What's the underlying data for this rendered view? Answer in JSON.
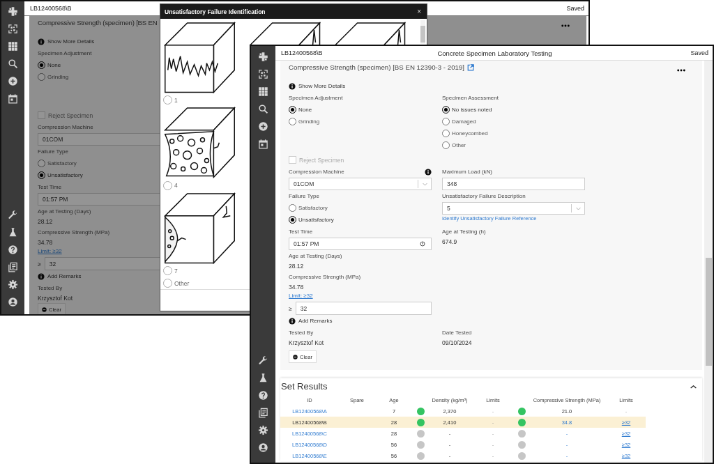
{
  "back_window": {
    "record_id": "LB12400568\\B",
    "status": "Saved",
    "card_title": "Compressive Strength (specimen) [BS EN",
    "rows": [
      {
        "left": [
          {
            "kind": "info_link",
            "text": "Show More Details"
          }
        ]
      },
      {
        "left": [
          {
            "kind": "label",
            "text": "Specimen Adjustment"
          },
          {
            "kind": "radio",
            "text": "None",
            "selected": true
          },
          {
            "kind": "radio",
            "text": "Grinding",
            "selected": false
          }
        ]
      },
      {
        "left": [
          {
            "kind": "checkbox",
            "text": "Reject Specimen",
            "checked": false,
            "disabled": true
          }
        ]
      },
      {
        "left": [
          {
            "kind": "label",
            "text": "Compression Machine"
          },
          {
            "kind": "select",
            "value": "01COM"
          },
          {
            "kind": "label",
            "text": "Failure Type"
          },
          {
            "kind": "radio",
            "text": "Satisfactory",
            "selected": false
          },
          {
            "kind": "radio",
            "text": "Unsatisfactory",
            "selected": true
          }
        ]
      },
      {
        "left": [
          {
            "kind": "label",
            "text": "Test Time"
          },
          {
            "kind": "time",
            "value": "01:57 PM"
          },
          {
            "kind": "label",
            "text": "Age at Testing (Days)"
          },
          {
            "kind": "value",
            "text": "28.12"
          },
          {
            "kind": "label",
            "text": "Compressive Strength (MPa)"
          },
          {
            "kind": "value",
            "text": "34.78"
          },
          {
            "kind": "limit_link",
            "text": "Limit: ≥32"
          },
          {
            "kind": "prefixed_input",
            "prefix": "≥",
            "value": "32"
          }
        ]
      },
      {
        "left": [
          {
            "kind": "info_link",
            "text": "Add Remarks"
          }
        ]
      },
      {
        "left": [
          {
            "kind": "label",
            "text": "Tested By"
          },
          {
            "kind": "value",
            "text": "Krzysztof Kot"
          },
          {
            "kind": "button",
            "text": "Clear"
          }
        ]
      }
    ]
  },
  "modal": {
    "title": "Unsatisfactory Failure Identification",
    "close": "×",
    "options": [
      {
        "kind": "image",
        "label": "1",
        "selected": false
      },
      {
        "kind": "image",
        "label": "4",
        "selected": false
      },
      {
        "kind": "image",
        "label": "7",
        "selected": false
      },
      {
        "kind": "plain",
        "label": "Other",
        "selected": false
      }
    ]
  },
  "front_window": {
    "record_id": "LB12400568\\B",
    "title": "Concrete Specimen Laboratory Testing",
    "status": "Saved",
    "card_title": "Compressive Strength (specimen) [BS EN 12390-3 - 2019]",
    "external_link": true,
    "rows": [
      {
        "left": [
          {
            "kind": "info_link",
            "text": "Show More Details"
          }
        ]
      },
      {
        "left": [
          {
            "kind": "label",
            "text": "Specimen Adjustment"
          },
          {
            "kind": "radio",
            "text": "None",
            "selected": true
          },
          {
            "kind": "radio",
            "text": "Grinding",
            "selected": false
          }
        ],
        "right": [
          {
            "kind": "label",
            "text": "Specimen Assessment"
          },
          {
            "kind": "radio",
            "text": "No issues noted",
            "selected": true
          },
          {
            "kind": "radio",
            "text": "Damaged",
            "selected": false
          },
          {
            "kind": "radio",
            "text": "Honeycombed",
            "selected": false
          },
          {
            "kind": "radio",
            "text": "Other",
            "selected": false
          }
        ]
      },
      {
        "left": [
          {
            "kind": "checkbox",
            "text": "Reject Specimen",
            "checked": false,
            "disabled": true
          }
        ]
      },
      {
        "left": [
          {
            "kind": "label",
            "text": "Compression Machine",
            "info": true
          },
          {
            "kind": "select",
            "value": "01COM"
          },
          {
            "kind": "label",
            "text": "Failure Type"
          },
          {
            "kind": "radio",
            "text": "Satisfactory",
            "selected": false
          },
          {
            "kind": "radio",
            "text": "Unsatisfactory",
            "selected": true
          }
        ],
        "right": [
          {
            "kind": "label",
            "text": "Maximum Load (kN)"
          },
          {
            "kind": "input",
            "value": "348"
          },
          {
            "kind": "label",
            "text": "Unsatisfactory Failure Description"
          },
          {
            "kind": "select",
            "value": "5"
          },
          {
            "kind": "link",
            "text": "Identify Unsatisfactory Failure Reference"
          }
        ]
      },
      {
        "left": [
          {
            "kind": "label",
            "text": "Test Time"
          },
          {
            "kind": "time",
            "value": "01:57 PM"
          },
          {
            "kind": "label",
            "text": "Age at Testing (Days)"
          },
          {
            "kind": "value",
            "text": "28.12"
          },
          {
            "kind": "label",
            "text": "Compressive Strength (MPa)"
          },
          {
            "kind": "value",
            "text": "34.78"
          },
          {
            "kind": "limit_link",
            "text": "Limit: ≥32"
          },
          {
            "kind": "prefixed_input",
            "prefix": "≥",
            "value": "32"
          }
        ],
        "right": [
          {
            "kind": "label",
            "text": "Age at Testing (h)"
          },
          {
            "kind": "value",
            "text": "674.9"
          }
        ]
      },
      {
        "left": [
          {
            "kind": "info_link",
            "text": "Add Remarks"
          }
        ]
      },
      {
        "left": [
          {
            "kind": "label",
            "text": "Tested By"
          },
          {
            "kind": "value",
            "text": "Krzysztof Kot"
          },
          {
            "kind": "button",
            "text": "Clear"
          }
        ],
        "right": [
          {
            "kind": "label",
            "text": "Date Tested"
          },
          {
            "kind": "value",
            "text": "09/10/2024"
          }
        ]
      }
    ],
    "set_results": {
      "title": "Set Results",
      "expanded": true,
      "columns": [
        "ID",
        "Spare",
        "Age",
        "Density (kg/m³)",
        "Limits",
        "Compressive Strength (MPa)",
        "Limits"
      ],
      "rows": [
        {
          "id": "LB12400568\\A",
          "selected": false,
          "age": "7",
          "density_status": {
            "color": "#34c462"
          },
          "density": "2,370",
          "density_limits": "-",
          "strength_status": {
            "color": "#34c462"
          },
          "strength": "21.0",
          "strength_link": false,
          "strength_limits": "-",
          "limits_link": false
        },
        {
          "id": "LB12400568\\B",
          "selected": true,
          "age": "28",
          "density_status": {
            "color": "#34c462"
          },
          "density": "2,410",
          "density_limits": "-",
          "strength_status": {
            "color": "#34c462"
          },
          "strength": "34.8",
          "strength_link": true,
          "strength_limits": "≥32",
          "limits_link": true
        },
        {
          "id": "LB12400568\\C",
          "selected": false,
          "age": "28",
          "density_status": {
            "color": "#c6c6c6"
          },
          "density": "-",
          "density_limits": "-",
          "strength_status": {
            "color": "#c6c6c6"
          },
          "strength": "-",
          "strength_link": true,
          "strength_limits": "≥32",
          "limits_link": true
        },
        {
          "id": "LB12400568\\D",
          "selected": false,
          "age": "56",
          "density_status": {
            "color": "#c6c6c6"
          },
          "density": "-",
          "density_limits": "-",
          "strength_status": {
            "color": "#c6c6c6"
          },
          "strength": "-",
          "strength_link": true,
          "strength_limits": "≥32",
          "limits_link": true
        },
        {
          "id": "LB12400568\\E",
          "selected": false,
          "age": "56",
          "density_status": {
            "color": "#c6c6c6"
          },
          "density": "-",
          "density_limits": "-",
          "strength_status": {
            "color": "#c6c6c6"
          },
          "strength": "-",
          "strength_link": true,
          "strength_limits": "≥32",
          "limits_link": true
        }
      ]
    }
  }
}
